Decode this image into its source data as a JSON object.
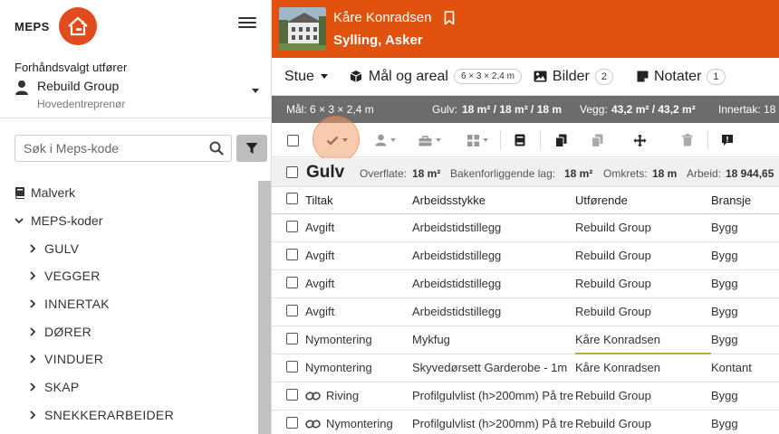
{
  "brand": {
    "name": "MEPS"
  },
  "sidebar": {
    "executor_label": "Forhåndsvalgt utfører",
    "executor_name": "Rebuild Group",
    "executor_role": "Hovedentreprenør",
    "search_placeholder": "Søk i Meps-kode",
    "tree": {
      "malverk": "Malverk",
      "meps_koder": "MEPS-koder",
      "children": [
        "GULV",
        "VEGGER",
        "INNERTAK",
        "DØRER",
        "VINDUER",
        "SKAP",
        "SNEKKERARBEIDER"
      ]
    }
  },
  "header": {
    "project_name": "Kåre Konradsen",
    "project_place": "Sylling, Asker"
  },
  "tabs": {
    "room": "Stue",
    "measure": "Mål og areal",
    "measure_pill": "6 × 3 × 2,4 m",
    "images": "Bilder",
    "images_count": "2",
    "notes": "Notater",
    "notes_count": "1"
  },
  "metrics": {
    "mal": "Mål: 6 × 3 × 2,4 m",
    "gulv_label": "Gulv:",
    "gulv_value": "18 m² / 18 m² / 18 m",
    "vegg_label": "Vegg:",
    "vegg_value": "43,2 m² / 43,2 m²",
    "innertak": "Innertak: 18"
  },
  "section": {
    "title": "Gulv",
    "overflate_label": "Overflate:",
    "overflate_value": "18 m²",
    "bakenforliggende_label": "Bakenforliggende lag:",
    "bakenforliggende_value": "18 m²",
    "omkrets_label": "Omkrets:",
    "omkrets_value": "18 m",
    "arbeid_label": "Arbeid:",
    "arbeid_value": "18 944,65"
  },
  "table": {
    "columns": [
      "Tiltak",
      "Arbeidsstykke",
      "Utførende",
      "Bransje"
    ],
    "rows": [
      {
        "tiltak": "Avgift",
        "arbeidsstykke": "Arbeidstidstillegg",
        "utforende": "Rebuild Group",
        "bransje": "Bygg"
      },
      {
        "tiltak": "Avgift",
        "arbeidsstykke": "Arbeidstidstillegg",
        "utforende": "Rebuild Group",
        "bransje": "Bygg"
      },
      {
        "tiltak": "Avgift",
        "arbeidsstykke": "Arbeidstidstillegg",
        "utforende": "Rebuild Group",
        "bransje": "Bygg"
      },
      {
        "tiltak": "Avgift",
        "arbeidsstykke": "Arbeidstidstillegg",
        "utforende": "Rebuild Group",
        "bransje": "Bygg"
      },
      {
        "tiltak": "Nymontering",
        "arbeidsstykke": "Mykfug",
        "utforende": "Kåre Konradsen",
        "bransje": "Bygg"
      },
      {
        "tiltak": "Nymontering",
        "arbeidsstykke": "Skyvedørsett Garderobe - 1m",
        "utforende": "Kåre Konradsen",
        "bransje": "Kontant"
      },
      {
        "tiltak": "Riving",
        "arbeidsstykke": "Profilgulvlist (h>200mm) På tre",
        "utforende": "Rebuild Group",
        "bransje": "Bygg"
      },
      {
        "tiltak": "Nymontering",
        "arbeidsstykke": "Profilgulvlist (h>200mm) På tre",
        "utforende": "Rebuild Group",
        "bransje": "Bygg"
      }
    ]
  },
  "colors": {
    "accent": "#e2520f",
    "metrics_bg": "#6c6c6c"
  }
}
